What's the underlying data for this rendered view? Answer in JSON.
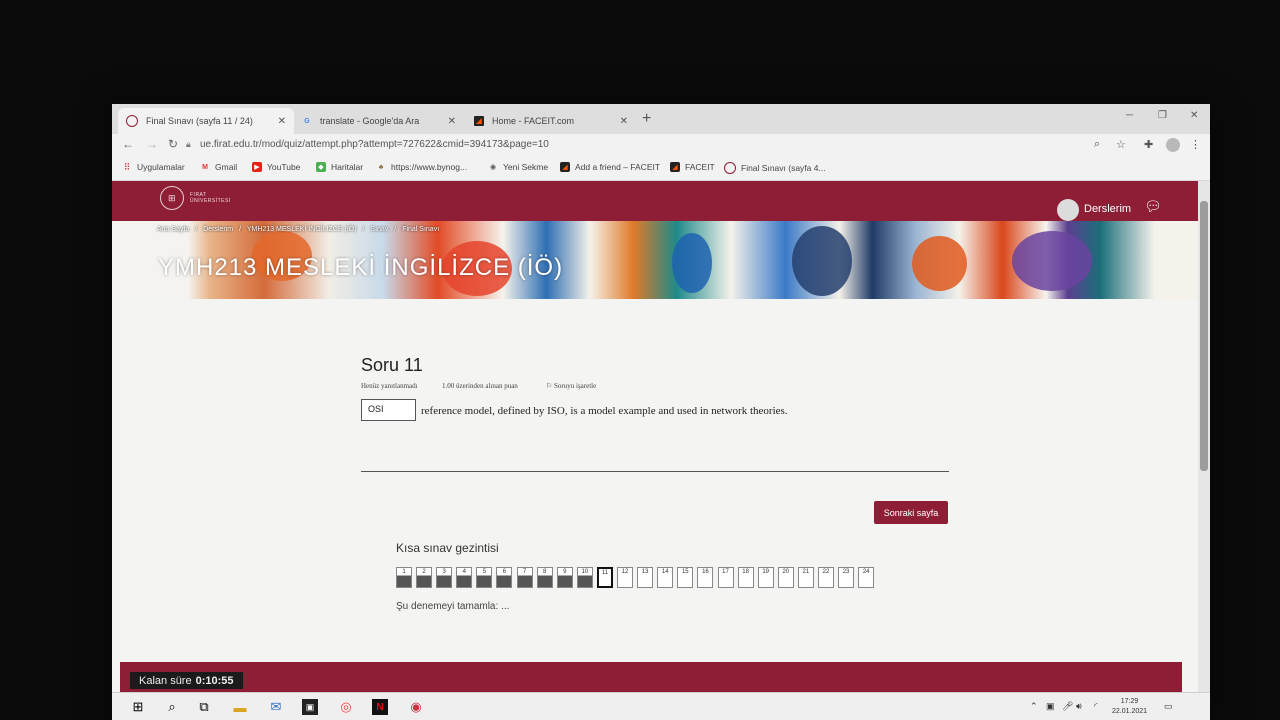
{
  "browser": {
    "tabs": [
      {
        "title": "Final Sınavı (sayfa 11 / 24)",
        "active": true
      },
      {
        "title": "translate - Google'da Ara",
        "active": false
      },
      {
        "title": "Home - FACEIT.com",
        "active": false
      }
    ],
    "url": "ue.firat.edu.tr/mod/quiz/attempt.php?attempt=727622&cmid=394173&page=10",
    "bookmarks": [
      "Uygulamalar",
      "Gmail",
      "YouTube",
      "Haritalar",
      "https://www.bynog...",
      "Yeni Sekme",
      "Add a friend – FACEIT",
      "FACEIT",
      "Final Sınavı (sayfa 4..."
    ]
  },
  "site": {
    "logo_line1": "FIRAT",
    "logo_line2": "ÜNİVERSİTESİ",
    "user_menu": "Derslerim",
    "breadcrumb": [
      "Ana Sayfa",
      "/",
      "Derslerim",
      "/",
      "YMH213 MESLEKİ İNGİLİZCE (İÖ)",
      "/",
      "Sınav",
      "/",
      "Final Sınavı"
    ],
    "course_title": "YMH213 MESLEKİ İNGİLİZCE (İÖ)"
  },
  "question": {
    "title": "Soru 11",
    "status": "Henüz yanıtlanmadı",
    "points": "1.00 üzerinden alınan puan",
    "flag": "Soruyu işaretle",
    "answer_value": "OSI",
    "text": "reference model, defined by ISO, is a model example and used in network theories."
  },
  "next_button": "Sonraki sayfa",
  "quiz_nav": {
    "title": "Kısa sınav gezintisi",
    "buttons": [
      "1",
      "2",
      "3",
      "4",
      "5",
      "6",
      "7",
      "8",
      "9",
      "10",
      "11",
      "12",
      "13",
      "14",
      "15",
      "16",
      "17",
      "18",
      "19",
      "20",
      "21",
      "22",
      "23",
      "24"
    ],
    "answered_count": 10,
    "current": 11,
    "finish_link": "Şu denemeyi tamamla: ..."
  },
  "timer": {
    "label": "Kalan süre",
    "value": "0:10:55"
  },
  "taskbar": {
    "time": "17:29",
    "date": "22.01.2021"
  }
}
